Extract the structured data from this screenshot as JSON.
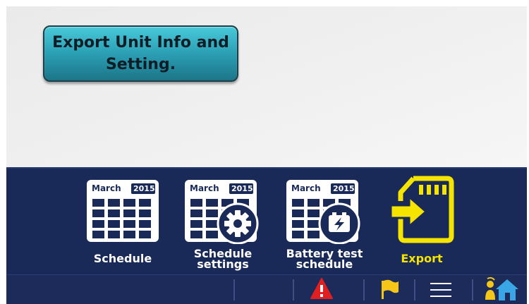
{
  "info_button": {
    "label": "Export Unit Info and Setting."
  },
  "toolbar": {
    "items": [
      {
        "label": "Schedule",
        "month": "March",
        "year": "2015"
      },
      {
        "label": "Schedule settings",
        "month": "March",
        "year": "2015"
      },
      {
        "label": "Battery test schedule",
        "month": "March",
        "year": "2015"
      },
      {
        "label": "Export"
      }
    ],
    "active_label_color": "#f5e400"
  },
  "statusbar": {
    "icons": [
      "warning-icon",
      "flag-icon",
      "menu-icon",
      "home-icon"
    ]
  },
  "colors": {
    "panel_bg": "#1a2a58",
    "accent_teal": "#2b9fb4",
    "export_yellow": "#f5e400",
    "warning_red": "#e02020",
    "flag_yellow": "#f5c518",
    "home_blue": "#3aa6e6"
  }
}
